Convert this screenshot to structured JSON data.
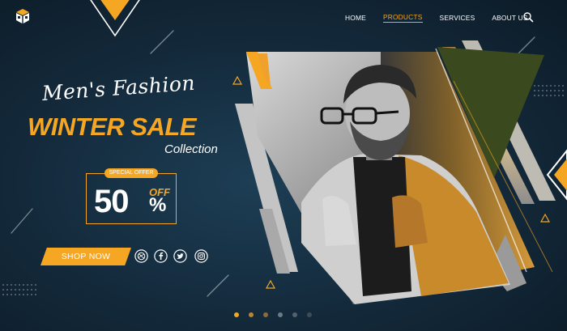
{
  "brand": {
    "logo_icon": "cube-logo-icon"
  },
  "nav": {
    "items": [
      {
        "label": "HOME",
        "active": false
      },
      {
        "label": "PRODUCTS",
        "active": true
      },
      {
        "label": "SERVICES",
        "active": false
      },
      {
        "label": "ABOUT US",
        "active": false
      }
    ],
    "search_icon": "search-icon"
  },
  "hero": {
    "script_title": "Men's Fashion",
    "sale_title": "WINTER SALE",
    "collection": "Collection",
    "offer": {
      "tag": "SPECIAL OFFER",
      "value": "50",
      "off": "OFF",
      "sign": "%"
    },
    "shop_button": "SHOP NOW",
    "social_icons": [
      "dribbble-icon",
      "facebook-icon",
      "twitter-icon",
      "instagram-icon"
    ]
  },
  "carousel": {
    "slide_count": 6,
    "active_index": 0
  },
  "colors": {
    "accent": "#f5a623",
    "background": "#13293a",
    "olive": "#3b4a1e",
    "text": "#ffffff"
  }
}
